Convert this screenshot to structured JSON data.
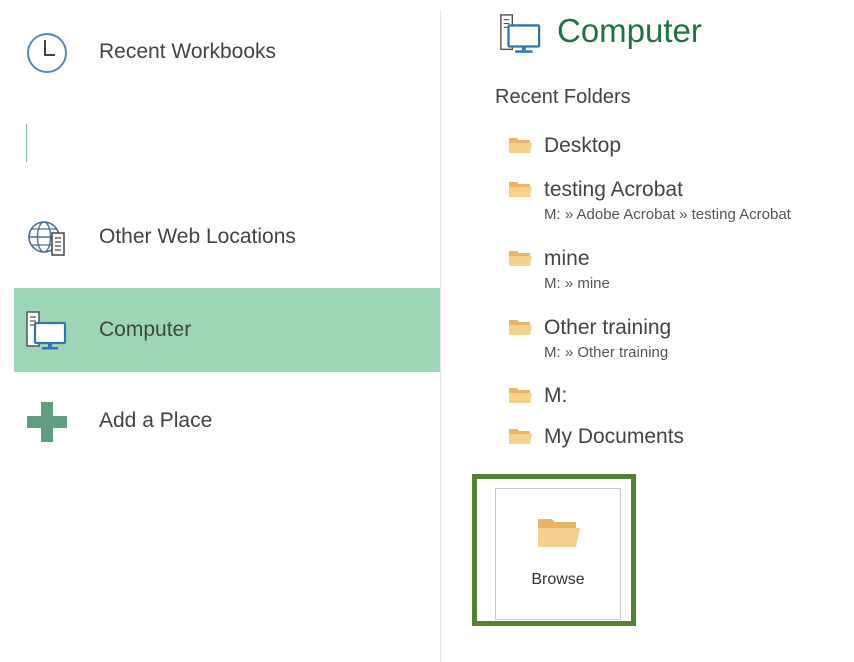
{
  "nav": {
    "items": [
      {
        "label": "Recent Workbooks",
        "icon": "clock-icon"
      },
      {
        "label": "Other Web Locations",
        "icon": "globe-server-icon"
      },
      {
        "label": "Computer",
        "icon": "computer-icon",
        "selected": true
      },
      {
        "label": "Add a Place",
        "icon": "plus-icon"
      }
    ]
  },
  "main": {
    "title": "Computer",
    "title_icon": "computer-icon",
    "section_title": "Recent Folders",
    "folders": [
      {
        "name": "Desktop",
        "path": ""
      },
      {
        "name": "testing Acrobat",
        "path": "M: » Adobe Acrobat » testing Acrobat"
      },
      {
        "name": "mine",
        "path": "M: » mine"
      },
      {
        "name": "Other training",
        "path": "M: » Other training"
      },
      {
        "name": "M:",
        "path": ""
      },
      {
        "name": "My Documents",
        "path": ""
      }
    ],
    "browse": {
      "label": "Browse",
      "icon": "folder-open-icon"
    }
  },
  "colors": {
    "accent": "#217346",
    "selected_bg": "#9fd5b7",
    "highlight_border": "#548235",
    "folder": "#f0c57a"
  }
}
